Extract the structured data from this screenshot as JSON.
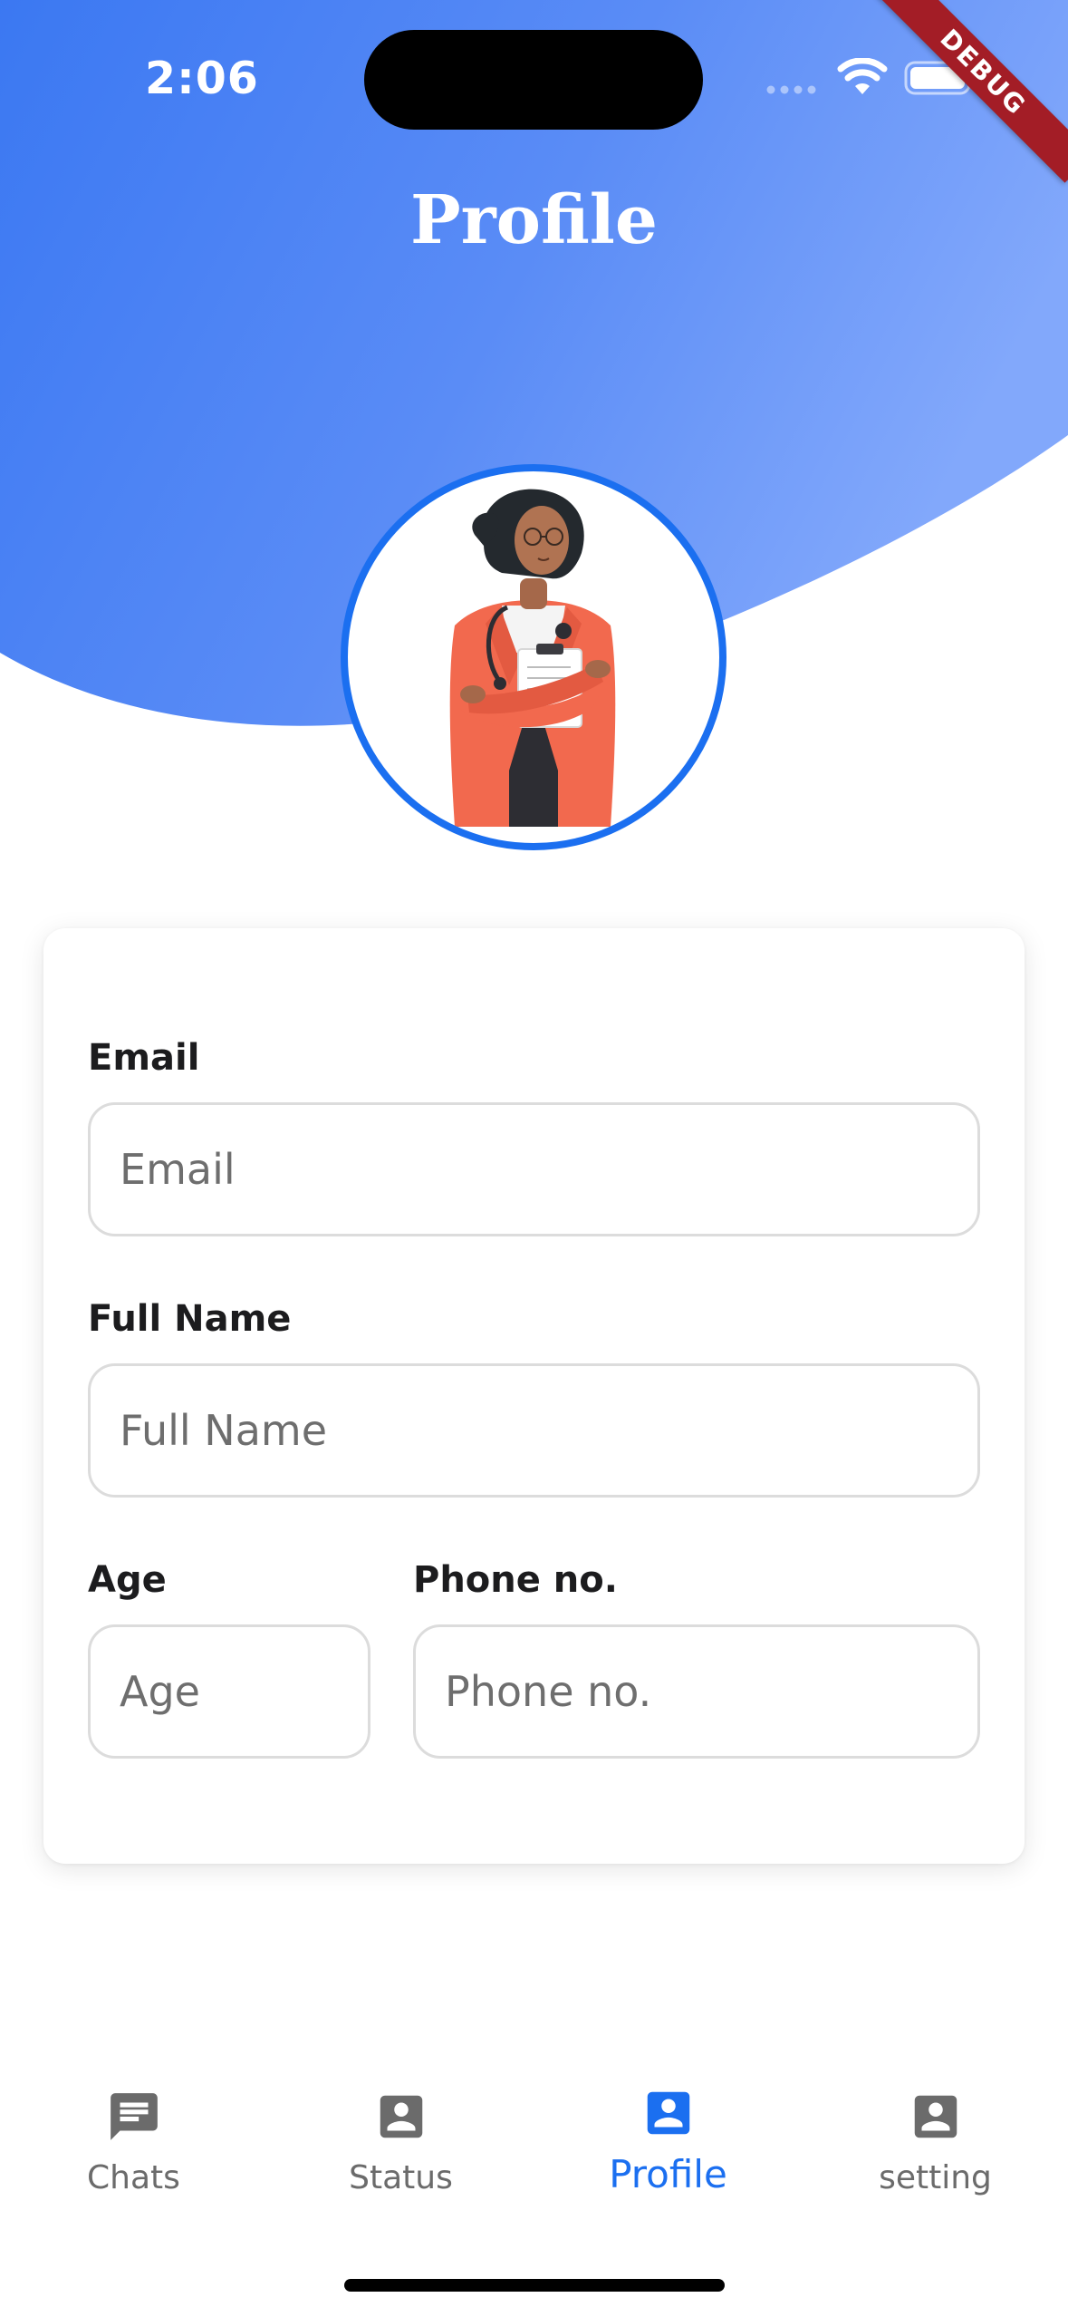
{
  "status_bar": {
    "time": "2:06"
  },
  "debug_banner": {
    "label": "DEBUG"
  },
  "header": {
    "title": "Profile"
  },
  "form": {
    "email": {
      "label": "Email",
      "placeholder": "Email",
      "value": ""
    },
    "full_name": {
      "label": "Full Name",
      "placeholder": "Full Name",
      "value": ""
    },
    "age": {
      "label": "Age",
      "placeholder": "Age",
      "value": ""
    },
    "phone": {
      "label": "Phone no.",
      "placeholder": "Phone no.",
      "value": ""
    }
  },
  "bottom_nav": {
    "items": [
      {
        "label": "Chats",
        "icon": "chat-icon",
        "active": false
      },
      {
        "label": "Status",
        "icon": "person-icon",
        "active": false
      },
      {
        "label": "Profile",
        "icon": "person-icon",
        "active": true
      },
      {
        "label": "setting",
        "icon": "person-icon",
        "active": false
      }
    ]
  },
  "colors": {
    "primary": "#1b6ff0",
    "header_gradient_start": "#3b78f2",
    "header_gradient_end": "#7ea6fb",
    "inactive_nav": "#6b6b6b",
    "debug_ribbon": "#a31d26"
  }
}
